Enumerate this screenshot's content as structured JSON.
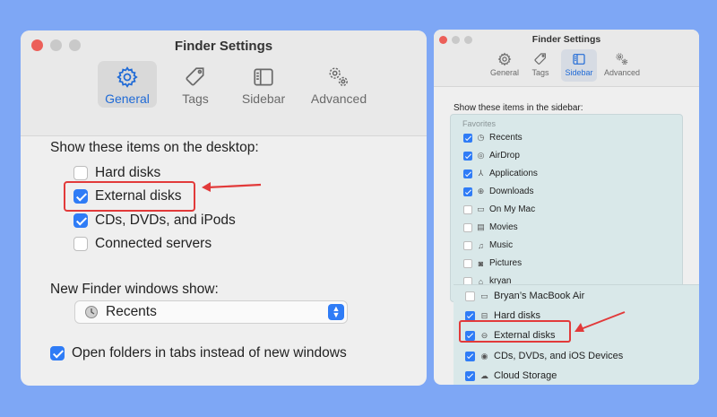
{
  "left": {
    "title": "Finder Settings",
    "tabs": [
      {
        "label": "General",
        "icon": "gear-icon",
        "active": true
      },
      {
        "label": "Tags",
        "icon": "tag-icon",
        "active": false
      },
      {
        "label": "Sidebar",
        "icon": "sidebar-icon",
        "active": false
      },
      {
        "label": "Advanced",
        "icon": "gears-icon",
        "active": false
      }
    ],
    "desktop_heading": "Show these items on the desktop:",
    "desktop_items": [
      {
        "label": "Hard disks",
        "checked": false
      },
      {
        "label": "External disks",
        "checked": true
      },
      {
        "label": "CDs, DVDs, and iPods",
        "checked": true
      },
      {
        "label": "Connected servers",
        "checked": false
      }
    ],
    "new_window_heading": "New Finder windows show:",
    "new_window_value": "Recents",
    "tabs_option": {
      "label": "Open folders in tabs instead of new windows",
      "checked": true
    }
  },
  "right": {
    "title": "Finder Settings",
    "tabs": [
      {
        "label": "General",
        "icon": "gear-icon",
        "active": false
      },
      {
        "label": "Tags",
        "icon": "tag-icon",
        "active": false
      },
      {
        "label": "Sidebar",
        "icon": "sidebar-icon",
        "active": true
      },
      {
        "label": "Advanced",
        "icon": "gears-icon",
        "active": false
      }
    ],
    "sidebar_heading": "Show these items in the sidebar:",
    "favorites_heading": "Favorites",
    "favorites": [
      {
        "label": "Recents",
        "checked": true,
        "icon": "clock-icon"
      },
      {
        "label": "AirDrop",
        "checked": true,
        "icon": "airdrop-icon"
      },
      {
        "label": "Applications",
        "checked": true,
        "icon": "applications-icon"
      },
      {
        "label": "Downloads",
        "checked": true,
        "icon": "download-icon"
      },
      {
        "label": "On My Mac",
        "checked": false,
        "icon": "folder-icon"
      },
      {
        "label": "Movies",
        "checked": false,
        "icon": "film-icon"
      },
      {
        "label": "Music",
        "checked": false,
        "icon": "music-icon"
      },
      {
        "label": "Pictures",
        "checked": false,
        "icon": "camera-icon"
      },
      {
        "label": "kryan",
        "checked": false,
        "icon": "home-icon"
      }
    ],
    "locations": [
      {
        "label": "Bryan’s MacBook Air",
        "checked": false,
        "icon": "laptop-icon"
      },
      {
        "label": "Hard disks",
        "checked": true,
        "icon": "disk-icon"
      },
      {
        "label": "External disks",
        "checked": true,
        "icon": "external-disk-icon"
      },
      {
        "label": "CDs, DVDs, and iOS Devices",
        "checked": true,
        "icon": "disc-icon"
      },
      {
        "label": "Cloud Storage",
        "checked": true,
        "icon": "cloud-icon"
      }
    ]
  },
  "colors": {
    "accent": "#2f7cf6",
    "highlight": "#e23a3a",
    "background": "#7ea7f5"
  }
}
